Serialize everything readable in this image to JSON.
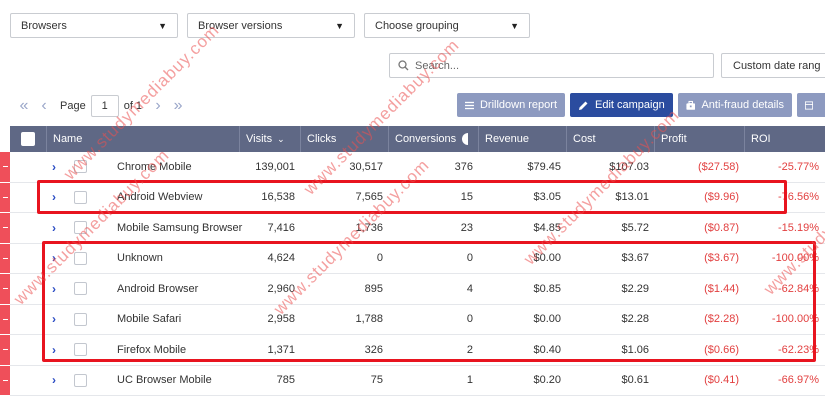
{
  "filters": {
    "browsers": "Browsers",
    "browser_versions": "Browser versions",
    "grouping": "Choose grouping"
  },
  "search": {
    "placeholder": "Search..."
  },
  "date_range": {
    "label": "Custom date rang"
  },
  "pager": {
    "label": "Page",
    "current": "1",
    "of": "of 1"
  },
  "actions": {
    "drilldown": "Drilldown report",
    "edit_campaign": "Edit campaign",
    "anti_fraud": "Anti-fraud details"
  },
  "colors": {
    "header": "#5f6885",
    "primary": "#2b4c9f",
    "muted_button": "#8d9ac0",
    "negative": "#e24040",
    "highlight": "#e8141f"
  },
  "table": {
    "columns": [
      "Name",
      "Visits",
      "Clicks",
      "Conversions",
      "Revenue",
      "Cost",
      "Profit",
      "ROI"
    ],
    "rows": [
      {
        "name": "Chrome Mobile",
        "visits": "139,001",
        "clicks": "30,517",
        "conversions": "376",
        "revenue": "$79.45",
        "cost": "$107.03",
        "profit": "($27.58)",
        "roi": "-25.77%"
      },
      {
        "name": "Android Webview",
        "visits": "16,538",
        "clicks": "7,565",
        "conversions": "15",
        "revenue": "$3.05",
        "cost": "$13.01",
        "profit": "($9.96)",
        "roi": "-76.56%"
      },
      {
        "name": "Mobile Samsung Browser",
        "visits": "7,416",
        "clicks": "1,736",
        "conversions": "23",
        "revenue": "$4.85",
        "cost": "$5.72",
        "profit": "($0.87)",
        "roi": "-15.19%"
      },
      {
        "name": "Unknown",
        "visits": "4,624",
        "clicks": "0",
        "conversions": "0",
        "revenue": "$0.00",
        "cost": "$3.67",
        "profit": "($3.67)",
        "roi": "-100.00%"
      },
      {
        "name": "Android Browser",
        "visits": "2,960",
        "clicks": "895",
        "conversions": "4",
        "revenue": "$0.85",
        "cost": "$2.29",
        "profit": "($1.44)",
        "roi": "-62.84%"
      },
      {
        "name": "Mobile Safari",
        "visits": "2,958",
        "clicks": "1,788",
        "conversions": "0",
        "revenue": "$0.00",
        "cost": "$2.28",
        "profit": "($2.28)",
        "roi": "-100.00%"
      },
      {
        "name": "Firefox Mobile",
        "visits": "1,371",
        "clicks": "326",
        "conversions": "2",
        "revenue": "$0.40",
        "cost": "$1.06",
        "profit": "($0.66)",
        "roi": "-62.23%"
      },
      {
        "name": "UC Browser Mobile",
        "visits": "785",
        "clicks": "75",
        "conversions": "1",
        "revenue": "$0.20",
        "cost": "$0.61",
        "profit": "($0.41)",
        "roi": "-66.97%"
      }
    ]
  },
  "watermark": "www.studymediabuy.com"
}
